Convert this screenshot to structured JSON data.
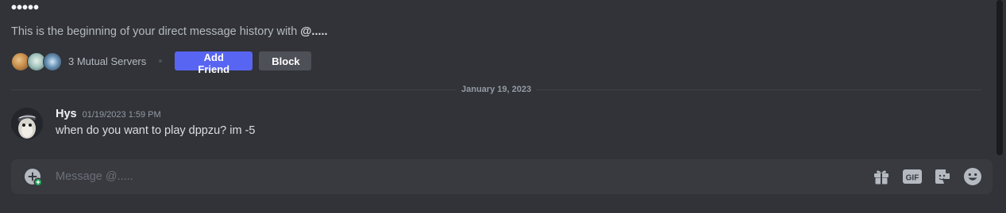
{
  "intro": {
    "name": "•••••",
    "description_prefix": "This is the beginning of your direct message history with ",
    "handle": "@.....",
    "mutual_servers": "3 Mutual Servers",
    "add_friend_label": "Add Friend",
    "block_label": "Block"
  },
  "divider": {
    "date": "January 19, 2023"
  },
  "message": {
    "username": "Hys",
    "timestamp": "01/19/2023 1:59 PM",
    "text": "when do you want to play dppzu? im -5"
  },
  "composer": {
    "placeholder": "Message @....."
  },
  "icons": {
    "add": "plus-circle-icon",
    "gift": "gift-icon",
    "gif": "gif-icon",
    "sticker": "sticker-icon",
    "emoji": "emoji-icon"
  },
  "colors": {
    "background": "#313338",
    "primary_button": "#5865f2",
    "secondary_button": "#4e5058",
    "composer": "#383a40",
    "online_badge": "#23a55a"
  }
}
